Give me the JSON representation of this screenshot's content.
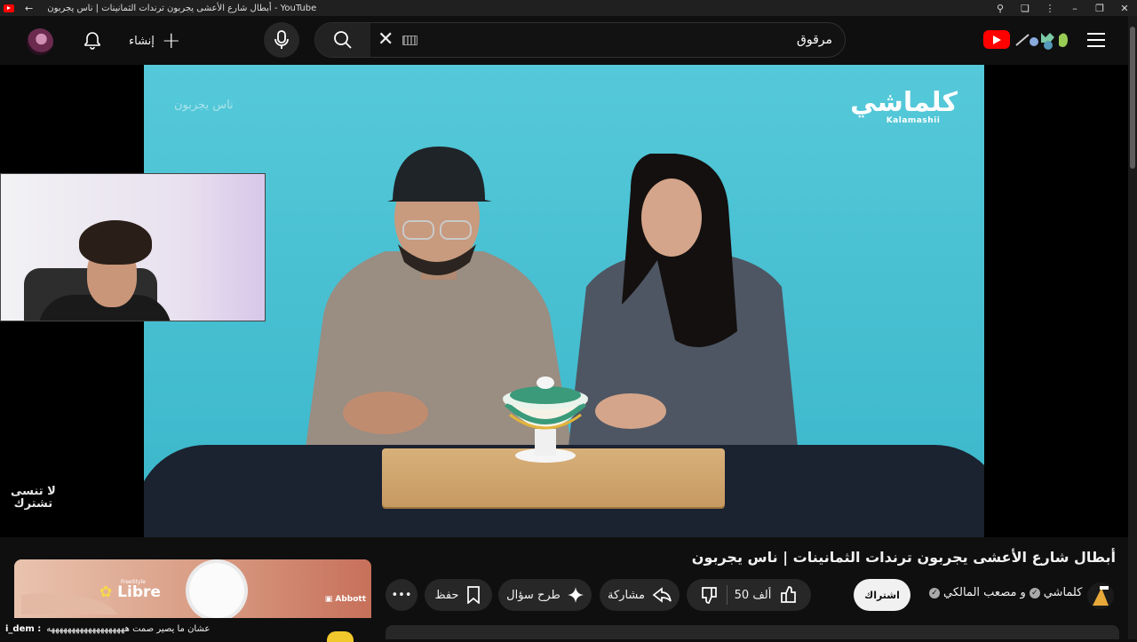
{
  "window": {
    "title": "أبطال شارع الأعشى يجربون ترندات الثمانينات | ناس يجربون - YouTube",
    "back_icon": "arrow-left-icon",
    "controls": [
      "zoom-icon",
      "extensions-icon",
      "more-vert-icon",
      "minimize-icon",
      "restore-icon",
      "close-icon"
    ]
  },
  "masthead": {
    "create_label": "إنشاء",
    "search_value": "مرقوق",
    "search_placeholder": "بحث"
  },
  "video": {
    "brand_ar": "كلماشي",
    "brand_en": "Kalamashii",
    "ghost_text": "ناس يجربون",
    "side_text_line1": "لا تنسى",
    "side_text_line2": "تشترك"
  },
  "ad": {
    "brand": "Libre",
    "brand_prefix": "FreeStyle",
    "sponsor": "Abbott"
  },
  "chat": {
    "user": "i_dem :",
    "message": "عشان ما يصير صمت هههههههههههههههههههه"
  },
  "watch": {
    "title": "أبطال شارع الأعشى يجربون ترندات الثمانينات | ناس يجربون",
    "channel_1": "كلماشي",
    "channel_sep": "و",
    "channel_2": "مصعب المالكي",
    "subscribe_label": "اشتراك",
    "likes": "50 ألف",
    "share_label": "مشاركة",
    "ask_label": "طرح سؤال",
    "save_label": "حفظ"
  },
  "colors": {
    "background": "#0f0f0f",
    "accent": "#ff0000",
    "video_bg": "#4cc3d6"
  }
}
